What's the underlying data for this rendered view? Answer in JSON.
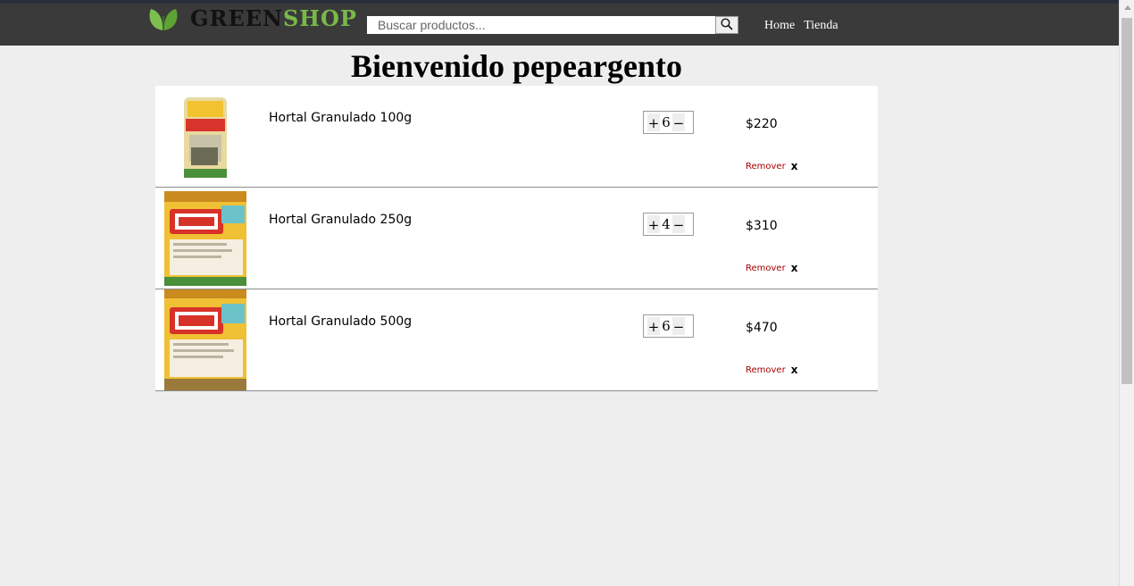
{
  "header": {
    "brand_part1": "GREEN",
    "brand_part2": "SHOP",
    "logo_icon": "leaf-icon",
    "search_placeholder": "Buscar productos...",
    "search_icon": "search-icon",
    "nav": [
      "Home",
      "Tienda"
    ]
  },
  "welcome": "Bienvenido pepeargento",
  "cart": {
    "plus_label": "+",
    "minus_label": "−",
    "remove_label": "Remover",
    "remove_x": "x",
    "items": [
      {
        "name": "Hortal Granulado 100g",
        "qty": "6",
        "price": "$220"
      },
      {
        "name": "Hortal Granulado 250g",
        "qty": "4",
        "price": "$310"
      },
      {
        "name": "Hortal Granulado 500g",
        "qty": "6",
        "price": "$470"
      }
    ]
  },
  "colors": {
    "topbar": "#3a3a3a",
    "brand_accent": "#78b94a",
    "remove": "#aa0000",
    "background": "#eeeeee"
  }
}
